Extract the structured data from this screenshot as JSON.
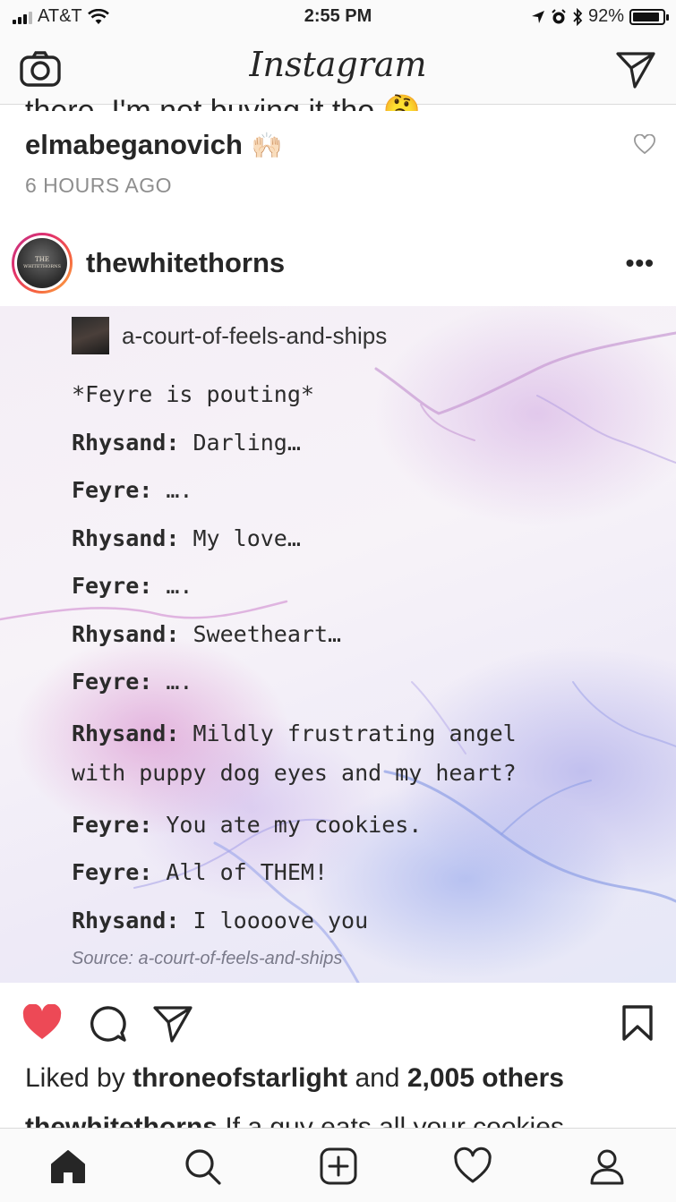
{
  "status_bar": {
    "carrier": "AT&T",
    "time": "2:55 PM",
    "battery": "92%",
    "battery_level": 0.92
  },
  "nav": {
    "title": "Instagram",
    "camera_icon": "camera-icon",
    "direct_icon": "paper-plane-icon"
  },
  "prev_comment": {
    "clipped_text": "there. I'm not buying it tho 🤔",
    "username": "elmabeganovich",
    "emoji": "🙌🏻",
    "time": "6 HOURS AGO"
  },
  "post": {
    "username": "thewhitethorns",
    "more": "•••",
    "avatar_text_1": "THE",
    "avatar_text_2": "WHITETHORNS",
    "image": {
      "source_user": "a-court-of-feels-and-ships",
      "lines": [
        {
          "speaker": "",
          "text": "*Feyre is pouting*"
        },
        {
          "speaker": "Rhysand:",
          "text": "Darling…"
        },
        {
          "speaker": "Feyre:",
          "text": "…."
        },
        {
          "speaker": "Rhysand:",
          "text": "My love…"
        },
        {
          "speaker": "Feyre:",
          "text": "…."
        },
        {
          "speaker": "Rhysand:",
          "text": "Sweetheart…"
        },
        {
          "speaker": "Feyre:",
          "text": "…."
        },
        {
          "speaker": "Rhysand:",
          "text": "Mildly frustrating angel"
        },
        {
          "speaker": "",
          "text": "with puppy dog eyes and my heart?"
        },
        {
          "speaker": "Feyre:",
          "text": "You ate my cookies."
        },
        {
          "speaker": "Feyre:",
          "text": "All of THEM!"
        },
        {
          "speaker": "Rhysand:",
          "text": "I loooove you"
        }
      ],
      "source_label": "Source:",
      "source_value": "a-court-of-feels-and-ships"
    },
    "liked": true,
    "likes_prefix": "Liked by",
    "likes_user": "throneofstarlight",
    "likes_and": "and",
    "likes_count": "2,005 others",
    "caption_user": "thewhitethorns",
    "caption_clipped": "If a guy eats all your cookies"
  },
  "colors": {
    "like_red": "#ed4956",
    "text": "#262626",
    "muted": "#8e8e8e"
  }
}
